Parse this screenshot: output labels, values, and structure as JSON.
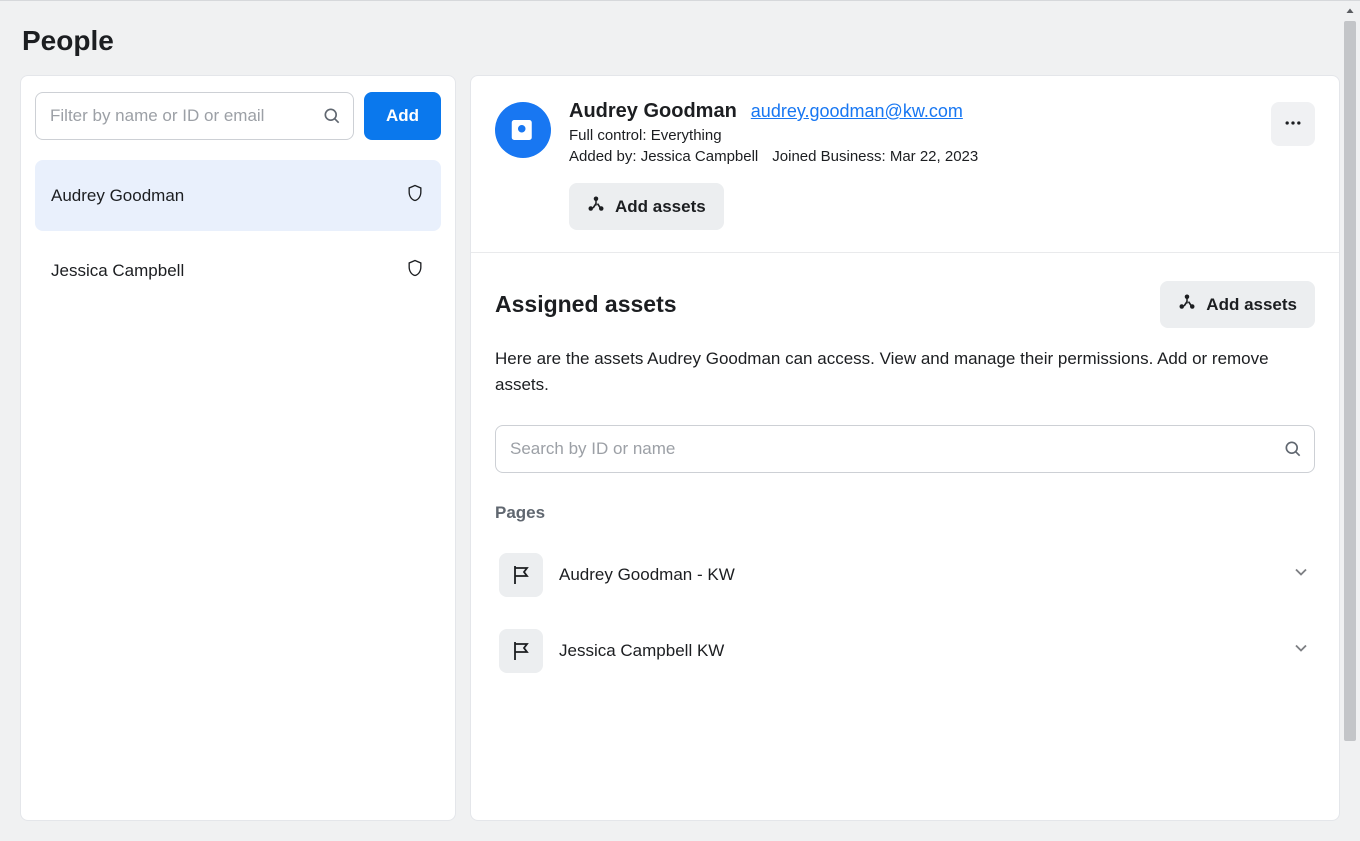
{
  "page_title": "People",
  "sidebar": {
    "filter_placeholder": "Filter by name or ID or email",
    "add_label": "Add",
    "people": [
      {
        "name": "Audrey Goodman",
        "selected": true
      },
      {
        "name": "Jessica Campbell",
        "selected": false
      }
    ]
  },
  "detail": {
    "name": "Audrey Goodman",
    "email": "audrey.goodman@kw.com",
    "role": "Full control: Everything",
    "added_by": "Added by: Jessica Campbell",
    "joined": "Joined Business: Mar 22, 2023",
    "add_assets_label": "Add assets"
  },
  "assigned": {
    "title": "Assigned assets",
    "add_assets_label": "Add assets",
    "description": "Here are the assets Audrey Goodman can access. View and manage their permissions. Add or remove assets.",
    "search_placeholder": "Search by ID or name",
    "pages_label": "Pages",
    "pages": [
      {
        "name": "Audrey Goodman - KW"
      },
      {
        "name": "Jessica Campbell KW"
      }
    ]
  }
}
